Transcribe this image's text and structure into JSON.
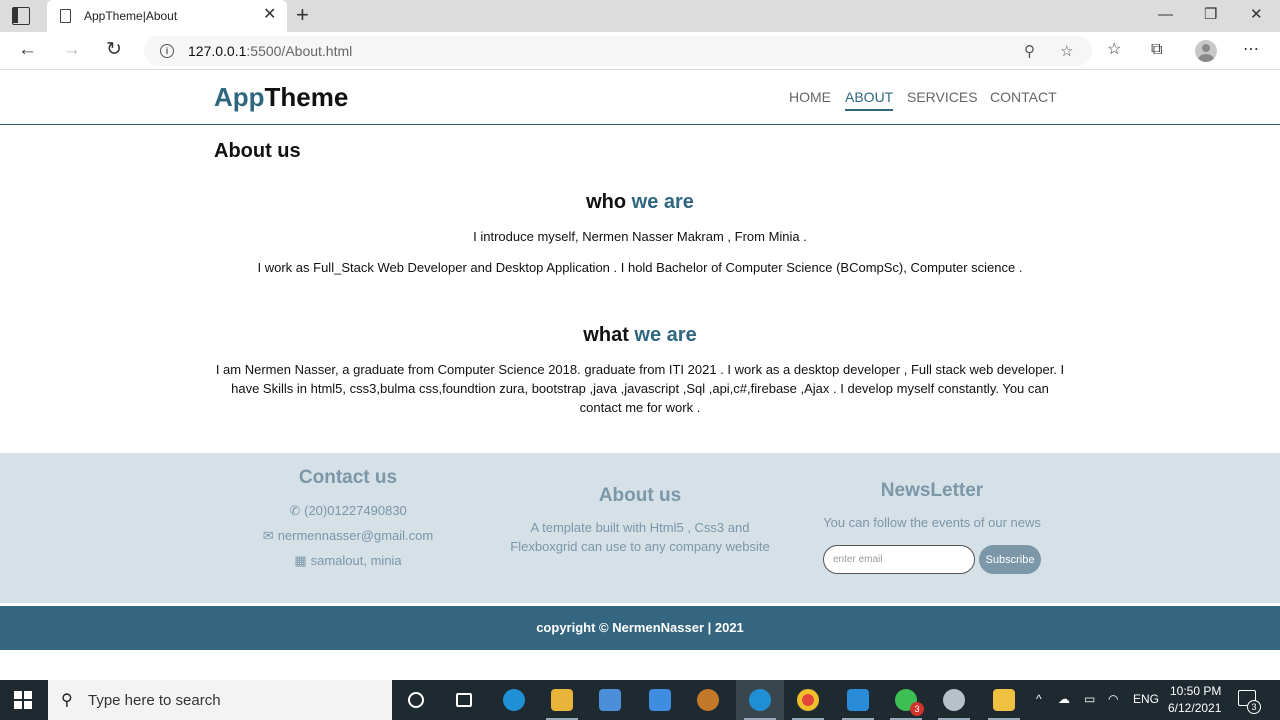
{
  "browser": {
    "tab_title": "AppTheme|About",
    "url_host": "127.0.0.1",
    "url_path": ":5500/About.html"
  },
  "site": {
    "logo_accent": "App",
    "logo_rest": "Theme",
    "nav": [
      {
        "label": "HOME"
      },
      {
        "label": "ABOUT",
        "active": true
      },
      {
        "label": "SERVICES"
      },
      {
        "label": "CONTACT"
      }
    ]
  },
  "content": {
    "heading": "About us",
    "who": {
      "title_plain": "who",
      "title_accent": "we are",
      "line1": "I introduce myself, Nermen Nasser Makram , From Minia .",
      "line2": "I work as Full_Stack Web Developer and Desktop Application . I hold Bachelor of Computer Science (BCompSc), Computer science ."
    },
    "what": {
      "title_plain": "what",
      "title_accent": "we are",
      "text": "I am Nermen Nasser, a graduate from Computer Science 2018. graduate from ITI 2021 . I work as a desktop developer , Full stack web developer. I have Skills in html5, css3,bulma css,foundtion zura, bootstrap ,java ,javascript ,Sql ,api,c#,firebase ,Ajax . I develop myself constantly. You can contact me for work ."
    }
  },
  "footer": {
    "contact": {
      "title": "Contact us",
      "phone": "(20)01227490830",
      "email": "nermennasser@gmail.com",
      "address": "samalout, minia"
    },
    "about": {
      "title": "About us",
      "text": "A template built with Html5 , Css3 and Flexboxgrid can use to any company website"
    },
    "newsletter": {
      "title": "NewsLetter",
      "text": "You can follow the events of our news",
      "placeholder": "enter email",
      "button": "Subscribe"
    },
    "copyright": "copyright © NermenNasser | 2021"
  },
  "taskbar": {
    "search_placeholder": "Type here to search",
    "language": "ENG",
    "time": "10:50 PM",
    "date": "6/12/2021",
    "whatsapp_badge": "3",
    "notification_count": "3"
  },
  "colors": {
    "accent": "#2f6680",
    "footer_bg": "#d6e0e7",
    "footer_text": "#7b97a8",
    "copyright_bg": "#356680"
  }
}
